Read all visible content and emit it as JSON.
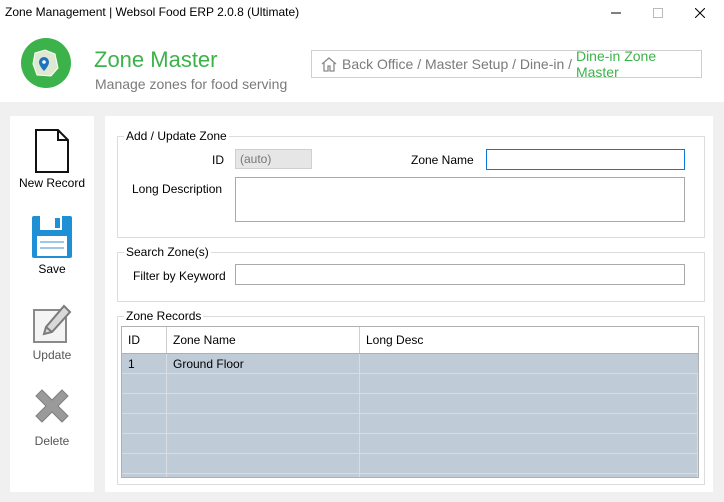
{
  "window": {
    "title": "Zone Management | Websol Food ERP 2.0.8 (Ultimate)"
  },
  "header": {
    "app_title": "Zone Master",
    "subtitle": "Manage zones for food serving",
    "breadcrumb": {
      "path": "Back Office / Master Setup / Dine-in / ",
      "current": "Dine-in Zone Master"
    }
  },
  "toolbar": {
    "new_label": "New Record",
    "save_label": "Save",
    "update_label": "Update",
    "delete_label": "Delete"
  },
  "add_update": {
    "legend": "Add / Update Zone",
    "id_label": "ID",
    "id_value": "(auto)",
    "zone_name_label": "Zone Name",
    "zone_name_value": "",
    "long_desc_label": "Long Description",
    "long_desc_value": ""
  },
  "search": {
    "legend": "Search Zone(s)",
    "filter_label": "Filter by Keyword",
    "filter_value": ""
  },
  "records": {
    "legend": "Zone Records",
    "columns": [
      "ID",
      "Zone Name",
      "Long Desc"
    ],
    "rows": [
      [
        "1",
        "Ground Floor",
        ""
      ]
    ]
  },
  "colors": {
    "accent_green": "#3cb34a",
    "grid_bg": "#bfccd8",
    "focus_blue": "#0b78d7"
  }
}
